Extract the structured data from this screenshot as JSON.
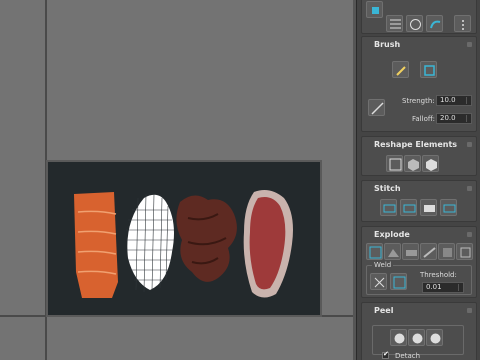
{
  "brush": {
    "title": "Brush",
    "strength_label": "Strength:",
    "strength_value": "10.0",
    "falloff_label": "Falloff:",
    "falloff_value": "20.0"
  },
  "reshape": {
    "title": "Reshape Elements"
  },
  "stitch": {
    "title": "Stitch"
  },
  "explode": {
    "title": "Explode",
    "weld_label": "Weld",
    "threshold_label": "Threshold:",
    "threshold_value": "0.01"
  },
  "peel": {
    "title": "Peel",
    "detach_label": "Detach",
    "detach_checked": true
  },
  "colors": {
    "panel": "#444444",
    "rollout": "#4d4d4d",
    "viewport": "#737373",
    "accent_cyan": "#3ab6d6"
  }
}
